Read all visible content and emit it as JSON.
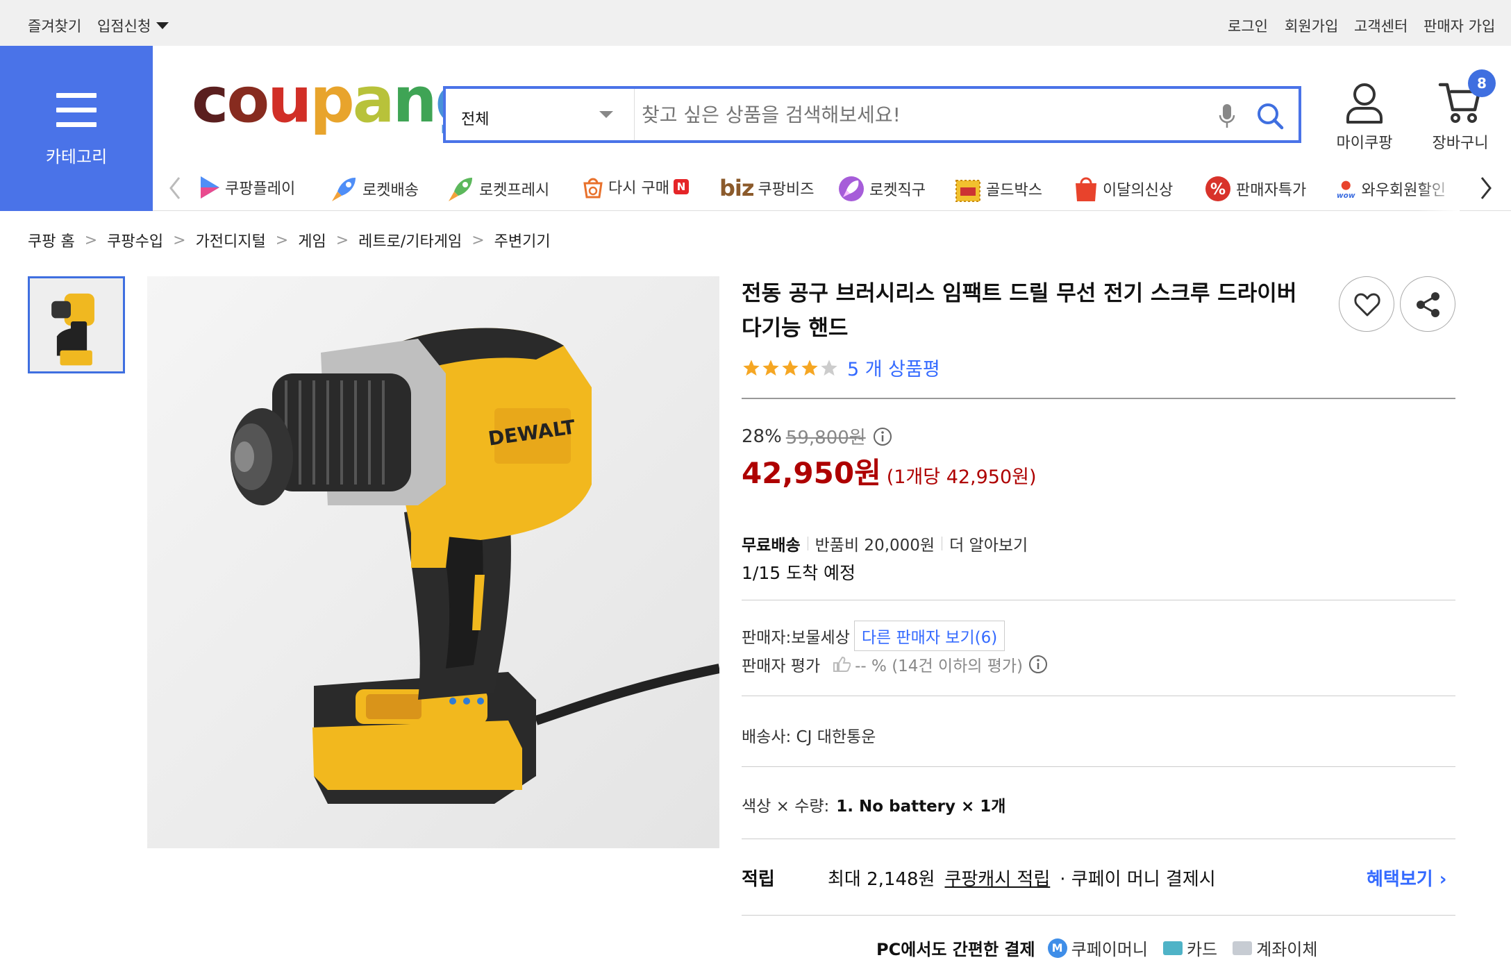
{
  "topbar": {
    "favorites": "즐겨찾기",
    "store_apply": "입점신청",
    "login": "로그인",
    "signup": "회원가입",
    "support": "고객센터",
    "seller_join": "판매자 가입"
  },
  "header": {
    "category_label": "카테고리",
    "logo_letters": [
      "c",
      "o",
      "u",
      "p",
      "a",
      "n",
      "g"
    ],
    "logo_colors": [
      "#5a1f1f",
      "#872b1f",
      "#d12f27",
      "#e8a42c",
      "#b8c23a",
      "#3fa455",
      "#4892d9"
    ],
    "search": {
      "scope": "전체",
      "placeholder": "찾고 싶은 상품을 검색해보세요!"
    },
    "my_coupang": "마이쿠팡",
    "cart": "장바구니",
    "cart_count": "8"
  },
  "cat_nav": [
    {
      "label": "쿠팡플레이",
      "icon": "play-icon"
    },
    {
      "label": "로켓배송",
      "icon": "rocket-icon"
    },
    {
      "label": "로켓프레시",
      "icon": "rocket-fresh-icon"
    },
    {
      "label": "다시 구매",
      "icon": "rebuy-icon",
      "badge": "N"
    },
    {
      "label": "쿠팡비즈",
      "icon": "biz-icon",
      "prefix": "biz"
    },
    {
      "label": "로켓직구",
      "icon": "rocket-global-icon"
    },
    {
      "label": "골드박스",
      "icon": "goldbox-icon"
    },
    {
      "label": "이달의신상",
      "icon": "new-icon"
    },
    {
      "label": "판매자특가",
      "icon": "percent-icon"
    },
    {
      "label": "와우회원할인",
      "icon": "wow-icon"
    }
  ],
  "breadcrumb": [
    "쿠팡 홈",
    "쿠팡수입",
    "가전디지털",
    "게임",
    "레트로/기타게임",
    "주변기기"
  ],
  "product": {
    "brand_on_image": "DEWALT",
    "title": "전동 공구 브러시리스 임팩트 드릴 무선 전기 스크루 드라이버 다기능 핸드",
    "stars": 4,
    "reviews": "5 개 상품평",
    "discount": "28%",
    "original_price": "59,800원",
    "price": "42,950원",
    "unit_price": "(1개당 42,950원)",
    "shipping": "무료배송",
    "return_fee": "반품비 20,000원",
    "learn_more": "더 알아보기",
    "arrival": "1/15 도착 예정",
    "seller_label": "판매자:",
    "seller": "보물세상",
    "other_sellers": "다른 판매자 보기(6)",
    "seller_rating_label": "판매자 평가",
    "seller_rating": "-- % (14건 이하의 평가)",
    "carrier": "배송사:  CJ 대한통운",
    "option_label": "색상 × 수량:",
    "option_value": "1. No battery × 1개",
    "reward_label": "적립",
    "reward_max": "최대 2,148원",
    "reward_cash": "쿠팡캐시 적립",
    "reward_cond": "· 쿠페이 머니 결제시",
    "reward_more": "혜택보기 ›",
    "pay_title": "PC에서도 간편한 결제",
    "pay_methods": [
      "쿠페이머니",
      "카드",
      "계좌이체"
    ]
  }
}
